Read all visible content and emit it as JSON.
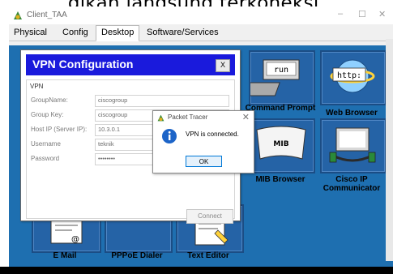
{
  "caption": "dikan langsung terkoneksi.",
  "window": {
    "title": "Client_TAA",
    "controls": [
      "–",
      "☐",
      "✕"
    ]
  },
  "tabs": [
    {
      "label": "Physical",
      "active": false
    },
    {
      "label": "Config",
      "active": false
    },
    {
      "label": "Desktop",
      "active": true
    },
    {
      "label": "Software/Services",
      "active": false
    }
  ],
  "desktop": {
    "background": "#1e6fb0",
    "apps": [
      {
        "label": "Command Prompt",
        "icon": "command-prompt-icon",
        "icon_text": "run"
      },
      {
        "label": "Web Browser",
        "icon": "web-browser-icon",
        "icon_text": "http:"
      },
      {
        "label": "MIB Browser",
        "icon": "mib-browser-icon",
        "icon_text": "MIB"
      },
      {
        "label": "Cisco IP Communicator",
        "icon": "cisco-ip-communicator-icon"
      },
      {
        "label": "E Mail",
        "icon": "email-icon"
      },
      {
        "label": "PPPoE Dialer",
        "icon": "pppoe-dialer-icon"
      },
      {
        "label": "Text Editor",
        "icon": "text-editor-icon"
      }
    ]
  },
  "vpn": {
    "title": "VPN Configuration",
    "close_label": "X",
    "group_title": "VPN",
    "fields": [
      {
        "label": "GroupName:",
        "value": "ciscogroup"
      },
      {
        "label": "Group Key:",
        "value": "ciscogroup"
      },
      {
        "label": "Host IP (Server IP):",
        "value": "10.3.0.1"
      },
      {
        "label": "Username",
        "value": "teknik"
      },
      {
        "label": "Password",
        "value": "••••••••"
      }
    ],
    "connect_label": "Connect"
  },
  "messagebox": {
    "title": "Packet Tracer",
    "close_label": "✕",
    "message": "VPN is connected.",
    "ok_label": "OK",
    "icon": "info-icon"
  },
  "colors": {
    "vpn_header": "#1a1adc",
    "desktop_tile": "#2563a6"
  }
}
